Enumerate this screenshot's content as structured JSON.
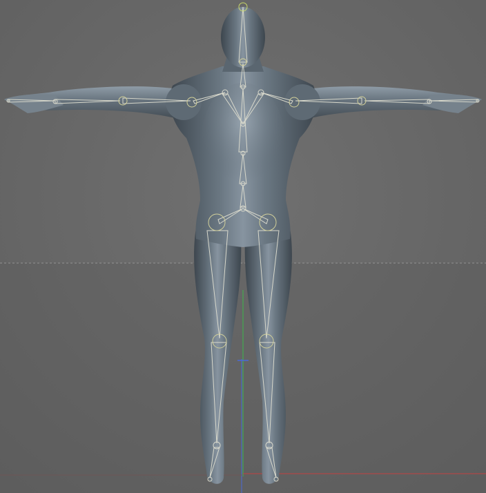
{
  "viewport": {
    "view": "front",
    "model": "humanoid-figure",
    "rig": "skeleton-overlay",
    "background_color": "#6a6a6a",
    "horizon_line": "dashed",
    "colors": {
      "background": "#6a6a6a",
      "skin": "#5e6a74",
      "skin_highlight": "#a9b6c0",
      "bone": "#d9d9cc",
      "joint": "#d2d09a",
      "head_joint": "#c8d86a",
      "axis_y": "#39c24a",
      "axis_x": "#c24141",
      "axis_z": "#4a6ad8",
      "grid": "#888888"
    },
    "joint_names": [
      "head",
      "neck",
      "chest",
      "spine",
      "hips",
      "left-shoulder",
      "left-elbow",
      "left-wrist",
      "left-hand",
      "right-shoulder",
      "right-elbow",
      "right-wrist",
      "right-hand",
      "left-hip",
      "left-knee",
      "left-ankle",
      "left-toe",
      "right-hip",
      "right-knee",
      "right-ankle",
      "right-toe"
    ]
  }
}
